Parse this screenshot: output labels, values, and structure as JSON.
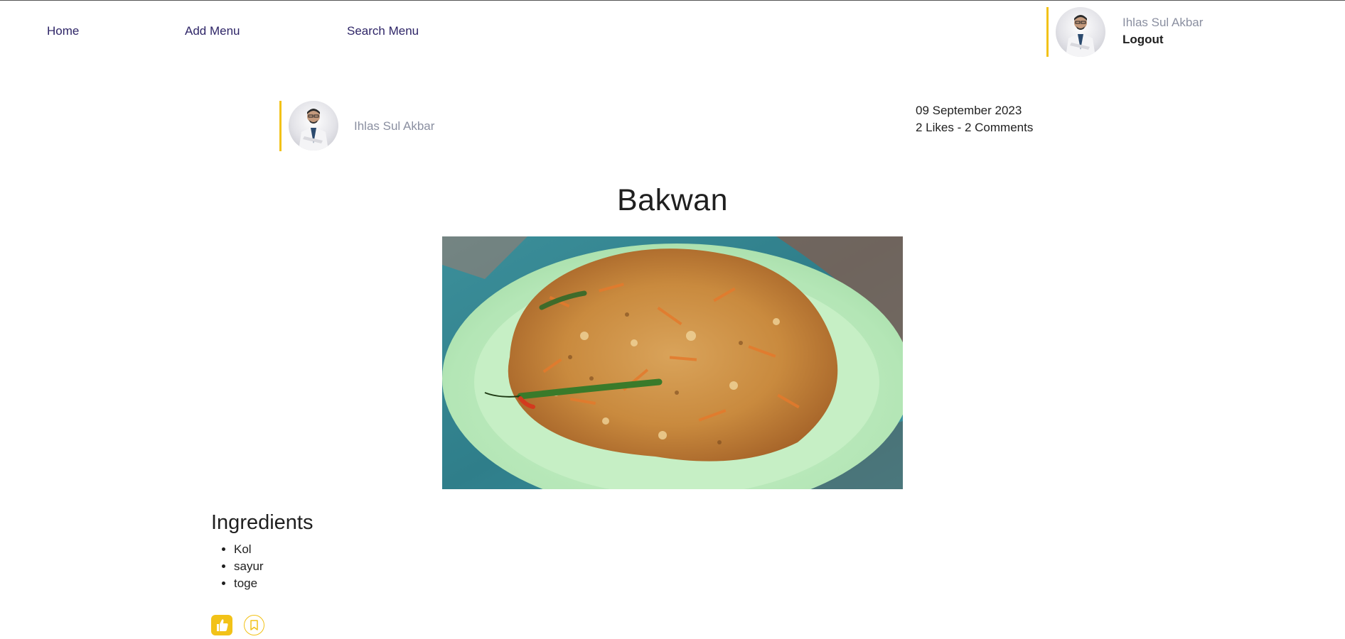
{
  "nav": {
    "home": "Home",
    "add_menu": "Add Menu",
    "search_menu": "Search Menu"
  },
  "user": {
    "name": "Ihlas Sul Akbar",
    "logout": "Logout"
  },
  "recipe": {
    "author": "Ihlas Sul Akbar",
    "date": "09 September 2023",
    "stats": "2 Likes - 2 Comments",
    "title": "Bakwan",
    "ingredients_heading": "Ingredients",
    "ingredients": [
      "Kol",
      "sayur",
      "toge"
    ]
  },
  "actions": {
    "like_icon": "thumbs-up-icon",
    "save_icon": "bookmark-icon"
  },
  "colors": {
    "accent": "#f2c218",
    "nav_text": "#2e2567",
    "muted_text": "#8a8fa0"
  }
}
